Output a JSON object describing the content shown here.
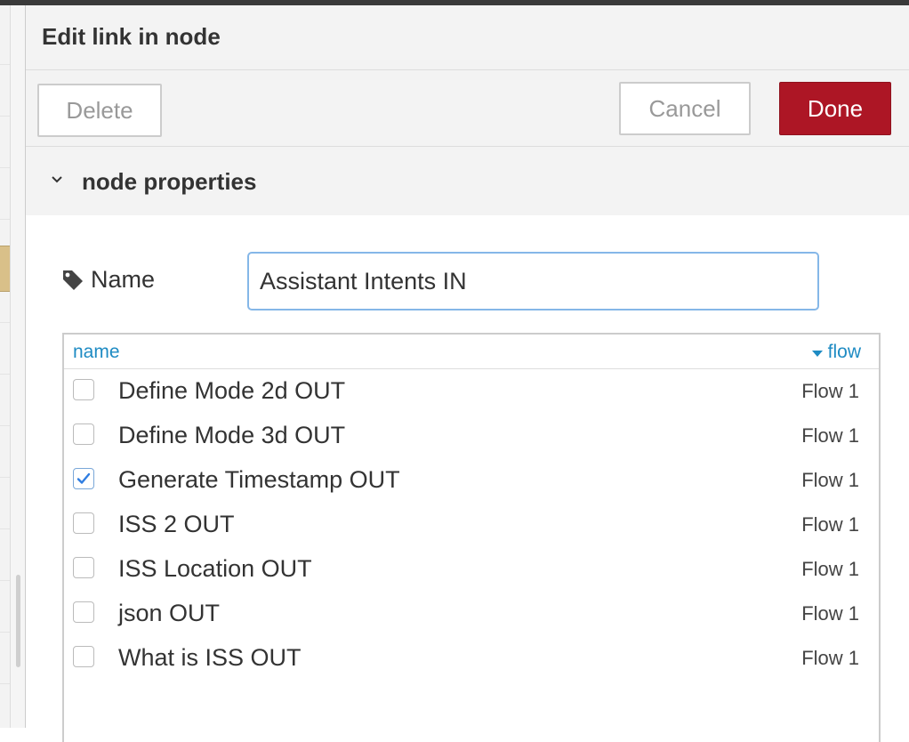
{
  "dialog": {
    "title": "Edit link in node",
    "delete_label": "Delete",
    "cancel_label": "Cancel",
    "done_label": "Done",
    "accent_color": "#ad1625"
  },
  "section": {
    "title": "node properties",
    "expanded": true,
    "icon": "chevron-down-icon"
  },
  "form": {
    "name_label": "Name",
    "name_icon": "tag-icon",
    "name_value": "Assistant Intents IN"
  },
  "link_table": {
    "columns": {
      "name": "name",
      "flow": "flow"
    },
    "sort_column": "flow",
    "rows": [
      {
        "name": "Define Mode 2d OUT",
        "flow": "Flow 1",
        "checked": false
      },
      {
        "name": "Define Mode 3d OUT",
        "flow": "Flow 1",
        "checked": false
      },
      {
        "name": "Generate Timestamp OUT",
        "flow": "Flow 1",
        "checked": true
      },
      {
        "name": "ISS 2 OUT",
        "flow": "Flow 1",
        "checked": false
      },
      {
        "name": "ISS Location OUT",
        "flow": "Flow 1",
        "checked": false
      },
      {
        "name": "json OUT",
        "flow": "Flow 1",
        "checked": false
      },
      {
        "name": "What is ISS OUT",
        "flow": "Flow 1",
        "checked": false
      }
    ]
  }
}
